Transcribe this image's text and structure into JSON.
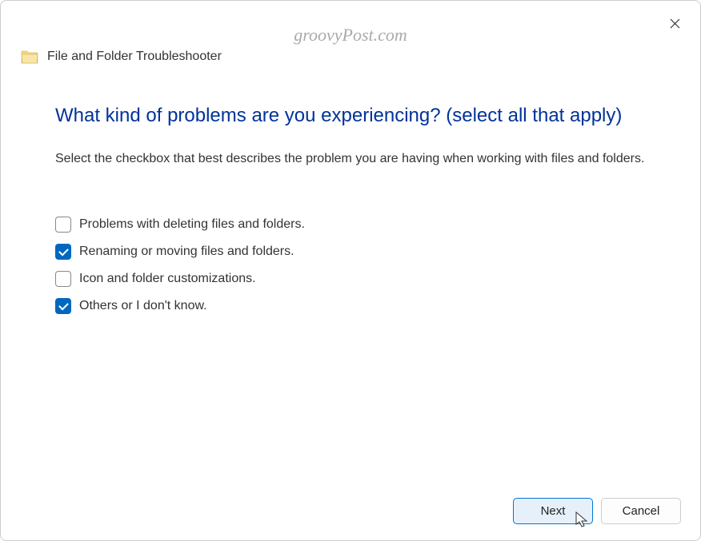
{
  "watermark": "groovyPost.com",
  "app_title": "File and Folder Troubleshooter",
  "heading": "What kind of problems are you experiencing? (select all that apply)",
  "description": "Select the checkbox that best describes the problem you are having when working with files and folders.",
  "options": [
    {
      "label": "Problems with deleting files and folders.",
      "checked": false
    },
    {
      "label": "Renaming or moving files and folders.",
      "checked": true
    },
    {
      "label": "Icon and folder customizations.",
      "checked": false
    },
    {
      "label": "Others or I don't know.",
      "checked": true
    }
  ],
  "buttons": {
    "next": "Next",
    "cancel": "Cancel"
  }
}
